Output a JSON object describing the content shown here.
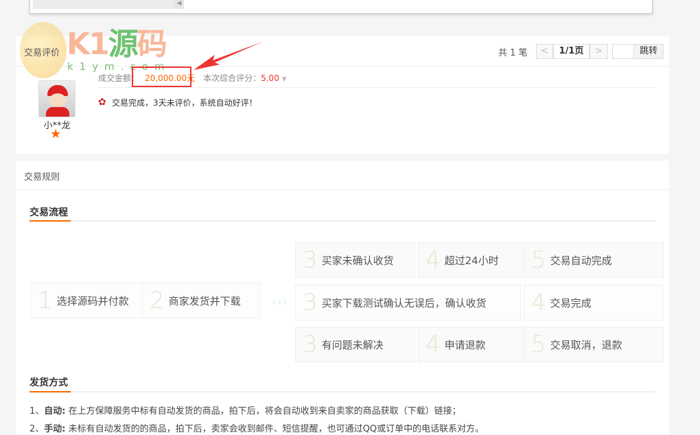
{
  "logo": {
    "text": "K1源码",
    "sub": "k1ym.com"
  },
  "review": {
    "title": "交易评价",
    "total_prefix": "共",
    "total": "1",
    "total_suffix": "笔",
    "prev": "<",
    "page": "1/1页",
    "next": ">",
    "jump": "跳转",
    "jump_value": "",
    "amount_label": "成交金额：",
    "amount": "20,000.00元",
    "score_label": "本次综合评分：",
    "score": "5.00",
    "comment": "交易完成，3天未评价，系统自动好评！",
    "user": "小**龙"
  },
  "rules": {
    "title": "交易规则",
    "flow_title": "交易流程",
    "steps": [
      {
        "n": "1",
        "t": "选择源码并付款"
      },
      {
        "n": "2",
        "t": "商家发货并下载"
      }
    ],
    "row1": [
      {
        "n": "3",
        "t": "买家未确认收货"
      },
      {
        "n": "4",
        "t": "超过24小时"
      },
      {
        "n": "5",
        "t": "交易自动完成"
      }
    ],
    "row2": [
      {
        "n": "3",
        "t": "买家下载测试确认无误后，确认收货"
      },
      {
        "n": "4",
        "t": "交易完成"
      }
    ],
    "row3": [
      {
        "n": "3",
        "t": "有问题未解决"
      },
      {
        "n": "4",
        "t": "申请退款"
      },
      {
        "n": "5",
        "t": "交易取消，退款"
      }
    ],
    "ship_title": "发货方式",
    "ship": [
      {
        "p": "1、",
        "b": "自动:",
        "t": "在上方保障服务中标有自动发货的商品，拍下后，将会自动收到来自卖家的商品获取（下载）链接；"
      },
      {
        "p": "2、",
        "b": "手动:",
        "t": "未标有自动发货的的商品，拍下后，卖家会收到邮件、短信提醒，也可通过QQ或订单中的电话联系对方。"
      }
    ]
  }
}
